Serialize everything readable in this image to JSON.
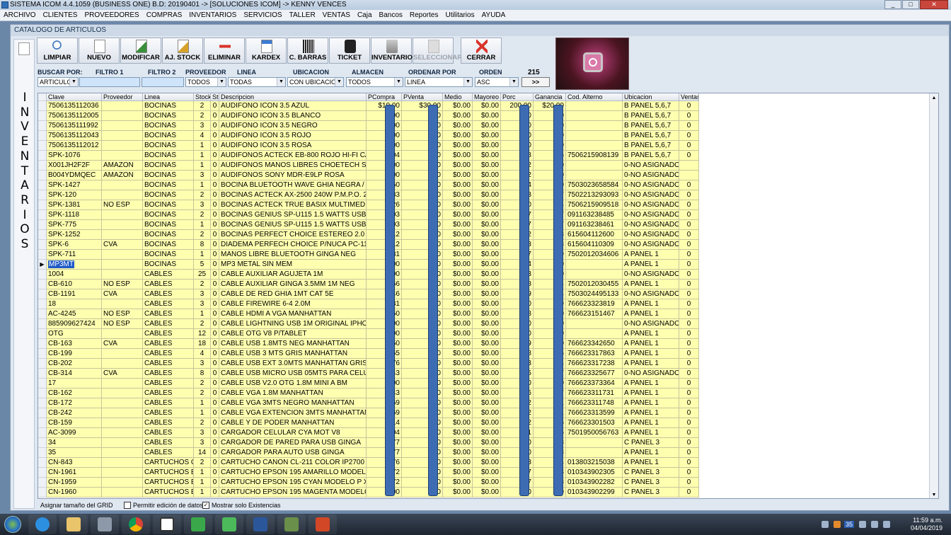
{
  "window": {
    "title": "SISTEMA ICOM 4.4.1059 (BUSINESS ONE)  B.D: 20190401  ->  [SOLUCIONES ICOM]  ->  KENNY VENCES"
  },
  "menu": [
    "ARCHIVO",
    "CLIENTES",
    "PROVEEDORES",
    "COMPRAS",
    "INVENTARIOS",
    "SERVICIOS",
    "TALLER",
    "VENTAS",
    "Caja",
    "Bancos",
    "Reportes",
    "Utilitarios",
    "AYUDA"
  ],
  "form": {
    "title": "CATALOGO DE ARTICULOS",
    "side_label": "I\nN\nV\nE\nN\nT\nA\nR\nI\nO\nS"
  },
  "toolbar": [
    {
      "label": "LIMPIAR",
      "enabled": true
    },
    {
      "label": "NUEVO",
      "enabled": true
    },
    {
      "label": "MODIFICAR",
      "enabled": true
    },
    {
      "label": "AJ. STOCK",
      "enabled": true
    },
    {
      "label": "ELIMINAR",
      "enabled": true
    },
    {
      "label": "KARDEX",
      "enabled": true
    },
    {
      "label": "C. BARRAS",
      "enabled": true
    },
    {
      "label": "TICKET",
      "enabled": true
    },
    {
      "label": "INVENTARIO",
      "enabled": true
    },
    {
      "label": "SELECCIONAR",
      "enabled": false
    },
    {
      "label": "CERRAR",
      "enabled": true
    }
  ],
  "filters": {
    "buscar_por": {
      "label": "BUSCAR POR:",
      "value": "ARTICULO"
    },
    "filtro1": {
      "label": "FILTRO 1",
      "value": ""
    },
    "filtro2": {
      "label": "FILTRO 2",
      "value": ""
    },
    "proveedor": {
      "label": "PROVEEDOR",
      "value": "TODOS"
    },
    "linea": {
      "label": "LINEA",
      "value": "TODAS"
    },
    "ubicacion": {
      "label": "UBICACION",
      "value": "CON UBICACION"
    },
    "almacen": {
      "label": "ALMACEN",
      "value": "TODOS"
    },
    "ordenar_por": {
      "label": "ORDENAR POR",
      "value": "LINEA"
    },
    "orden": {
      "label": "ORDEN",
      "value": "ASC"
    },
    "count": "215",
    "go_label": ">>"
  },
  "grid": {
    "columns": [
      "Clave",
      "Proveedor",
      "Linea",
      "Stock",
      "Sto",
      "Descripcion",
      "PCompra",
      "PVenta",
      "Medio",
      "Mayoreo",
      "Porc",
      "Ganancia",
      "Cod. Alterno",
      "Ubicacion",
      "Ventas"
    ],
    "selected_row": 16,
    "rows": [
      [
        "7506135112036",
        "",
        "BOCINAS",
        "2",
        "0",
        "AUDIFONO ICON 3.5 AZUL",
        "$10.00",
        "$30.00",
        "$0.00",
        "$0.00",
        "200.00",
        "$20.00",
        "",
        "B PANEL 5,6,7",
        "0"
      ],
      [
        "7506135112005",
        "",
        "BOCINAS",
        "2",
        "0",
        "AUDIFONO ICON 3.5 BLANCO",
        ".00",
        ".00",
        "$0.00",
        "$0.00",
        ".00",
        ".00",
        "",
        "B PANEL 5,6,7",
        "0"
      ],
      [
        "7506135111992",
        "",
        "BOCINAS",
        "3",
        "0",
        "AUDIFONO ICON 3.5 NEGRO",
        ".00",
        ".00",
        "$0.00",
        "$0.00",
        ".00",
        ".00",
        "",
        "B PANEL 5,6,7",
        "0"
      ],
      [
        "7506135112043",
        "",
        "BOCINAS",
        "4",
        "0",
        "AUDIFONO ICON 3.5 ROJO",
        ".00",
        ".00",
        "$0.00",
        "$0.00",
        ".00",
        ".00",
        "",
        "B PANEL 5,6,7",
        "0"
      ],
      [
        "7506135112012",
        "",
        "BOCINAS",
        "1",
        "0",
        "AUDIFONO ICON 3.5 ROSA",
        ".00",
        ".00",
        "$0.00",
        "$0.00",
        ".00",
        ".00",
        "",
        "B PANEL 5,6,7",
        "0"
      ],
      [
        "SPK-1076",
        "",
        "BOCINAS",
        "1",
        "0",
        "AUDIFONOS ACTECK EB-800 ROJO HI-FI CAB",
        ".04",
        ".00",
        "$0.00",
        "$0.00",
        ".68",
        ".96",
        "7506215908139",
        "B PANEL 5,6,7",
        "0"
      ],
      [
        "X001JH2F2F",
        "AMAZON",
        "BOCINAS",
        "1",
        "0",
        "AUDIFONOS MANOS LIBRES CHOETECH SUPE",
        ".00",
        ".00",
        "$0.00",
        "$0.00",
        ".52",
        ".00",
        "",
        "0-NO ASIGNADO",
        ""
      ],
      [
        "B004YDMQEC",
        "AMAZON",
        "BOCINAS",
        "3",
        "0",
        "AUDIFONOS SONY MDR-E9LP ROSA",
        ".00",
        ".00",
        "$0.00",
        "$0.00",
        ".92",
        ".00",
        "",
        "0-NO ASIGNADO",
        ""
      ],
      [
        "SPK-1427",
        "",
        "BOCINAS",
        "1",
        "0",
        "BOCINA BLUETOOTH WAVE GHIA NEGRA / NE",
        ".60",
        ".00",
        "$0.00",
        "$0.00",
        ".94",
        ".40",
        "7503023658584",
        "0-NO ASIGNADO",
        "0"
      ],
      [
        "SPK-120",
        "",
        "BOCINAS",
        "2",
        "0",
        "BOCINAS ACTECK AX-2500 240W P.M.P.O. 2",
        ".83",
        ".00",
        "$0.00",
        "$0.00",
        ".53",
        ".17",
        "7502213293093",
        "0-NO ASIGNADO",
        "0"
      ],
      [
        "SPK-1381",
        "NO ESP",
        "BOCINAS",
        "3",
        "0",
        "BOCINAS ACTECK TRUE BASIX MULTIMEDIA",
        ".26",
        ".00",
        "$0.00",
        "$0.00",
        ".10",
        ".74",
        "7506215909518",
        "0-NO ASIGNADO",
        "0"
      ],
      [
        "SPK-1118",
        "",
        "BOCINAS",
        "2",
        "0",
        "BOCINAS GENIUS SP-U115 1.5 WATTS USB A",
        ".03",
        ".00",
        "$0.00",
        "$0.00",
        ".27",
        ".97",
        "091163238485",
        "0-NO ASIGNADO",
        "0"
      ],
      [
        "SPK-775",
        "",
        "BOCINAS",
        "1",
        "0",
        "BOCINAS GENIUS SP-U115 1.5 WATTS USB N",
        ".03",
        ".00",
        "$0.00",
        "$0.00",
        ".27",
        ".97",
        "091163238461",
        "0-NO ASIGNADO",
        "0"
      ],
      [
        "SPK-1252",
        "",
        "BOCINAS",
        "2",
        "0",
        "BOCINAS PERFECT CHOICE ESTEREO 2.0 USE",
        ".12",
        ".00",
        "$0.00",
        "$0.00",
        ".12",
        ".88",
        "615604112600",
        "0-NO ASIGNADO",
        "0"
      ],
      [
        "SPK-6",
        "CVA",
        "BOCINAS",
        "8",
        "0",
        "DIADEMA PERFECH CHOICE P/NUCA PC-1103",
        ".12",
        ".00",
        "$0.00",
        "$0.00",
        ".23",
        ".88",
        "615604110309",
        "0-NO ASIGNADO",
        "0"
      ],
      [
        "SPK-711",
        "",
        "BOCINAS",
        "1",
        "0",
        "MANOS LIBRE BLUETOOTH GINGA NEG",
        ".81",
        ".00",
        "$0.00",
        "$0.00",
        ".67",
        ".19",
        "7502012034606",
        "A PANEL 1",
        "0"
      ],
      [
        "MP3MT",
        "",
        "BOCINAS",
        "5",
        "0",
        "MP3 METAL SIN MEM",
        ".00",
        ".00",
        "$0.00",
        "$0.00",
        ".14",
        ".00",
        "",
        "A PANEL 1",
        "0"
      ],
      [
        "1004",
        "",
        "CABLES",
        "25",
        "0",
        "CABLE AUXILIAR AGUJETA 1M",
        ".00",
        ".00",
        "$0.00",
        "$0.00",
        ".33",
        ".00",
        "",
        "0-NO ASIGNADO",
        "0"
      ],
      [
        "CB-610",
        "NO ESP",
        "CABLES",
        "2",
        "0",
        "CABLE AUXILIAR GINGA 3.5MM 1M NEG",
        ".66",
        ".00",
        "$0.00",
        "$0.00",
        ".08",
        ".34",
        "7502012030455",
        "A PANEL 1",
        "0"
      ],
      [
        "CB-1191",
        "CVA",
        "CABLES",
        "3",
        "0",
        "CABLE DE RED GHIA 1MT CAT 5E",
        ".46",
        ".00",
        "$0.00",
        "$0.00",
        ".59",
        ".54",
        "7503024495133",
        "0-NO ASIGNADO",
        "0"
      ],
      [
        "18",
        "",
        "CABLES",
        "3",
        "0",
        "CABLE FIREWIRE 6-4 2.0M",
        ".31",
        ".00",
        "$0.00",
        "$0.00",
        ".00",
        ".69",
        "766623323819",
        "A PANEL 1",
        "0"
      ],
      [
        "AC-4245",
        "NO ESP",
        "CABLES",
        "1",
        "0",
        "CABLE HDMI A VGA MANHATTAN",
        ".50",
        ".00",
        "$0.00",
        "$0.00",
        ".38",
        ".50",
        "766623151467",
        "A PANEL 1",
        "0"
      ],
      [
        "885909627424",
        "NO ESP",
        "CABLES",
        "2",
        "0",
        "CABLE LIGHTNING USB 1M ORIGINAL IPHONE",
        ".00",
        ".00",
        "$0.00",
        "$0.00",
        ".00",
        ".00",
        "",
        "0-NO ASIGNADO",
        "0"
      ],
      [
        "OTG",
        "",
        "CABLES",
        "12",
        "0",
        "CABLE OTG V8 P/TABLET",
        ".00",
        ".00",
        "$0.00",
        "$0.00",
        ".00",
        ".00",
        "",
        "A PANEL 1",
        "0"
      ],
      [
        "CB-163",
        "CVA",
        "CABLES",
        "18",
        "0",
        "CABLE USB 1.8MTS NEG MANHATTAN",
        ".50",
        ".00",
        "$0.00",
        "$0.00",
        ".09",
        ".50",
        "766623342650",
        "A PANEL 1",
        "0"
      ],
      [
        "CB-199",
        "",
        "CABLES",
        "4",
        "0",
        "CABLE USB 3 MTS GRIS MANHATTAN",
        ".65",
        ".00",
        "$0.00",
        "$0.00",
        ".18",
        ".35",
        "766623317863",
        "A PANEL 1",
        "0"
      ],
      [
        "CB-202",
        "",
        "CABLES",
        "3",
        "0",
        "CABLE USB EXT 3.0MTS MANHATTAN GRIS",
        ".76",
        ".00",
        "$0.00",
        "$0.00",
        ".03",
        ".24",
        "766623317238",
        "A PANEL 1",
        "0"
      ],
      [
        "CB-314",
        "CVA",
        "CABLES",
        "8",
        "0",
        "CABLE USB MICRO USB 05MTS PARA CELULA",
        ".43",
        ".00",
        "$0.00",
        "$0.00",
        ".55",
        ".57",
        "766623325677",
        "0-NO ASIGNADO",
        "0"
      ],
      [
        "17",
        "",
        "CABLES",
        "2",
        "0",
        "CABLE USB V2.0 OTG 1.8M MINI A BM",
        ".00",
        ".00",
        "$0.00",
        "$0.00",
        ".00",
        ".00",
        "766623373364",
        "A PANEL 1",
        "0"
      ],
      [
        "CB-162",
        "",
        "CABLES",
        "2",
        "0",
        "CABLE VGA 1.8M MANHATTAN",
        ".43",
        ".00",
        "$0.00",
        "$0.00",
        ".86",
        ".57",
        "766623311731",
        "A PANEL 1",
        "0"
      ],
      [
        "CB-172",
        "",
        "CABLES",
        "1",
        "0",
        "CABLE VGA 3MTS NEGRO MANHATTAN",
        ".69",
        ".00",
        "$0.00",
        "$0.00",
        ".72",
        ".31",
        "766623311748",
        "A PANEL 1",
        "0"
      ],
      [
        "CB-242",
        "",
        "CABLES",
        "1",
        "0",
        "CABLE VGA EXTENCION 3MTS MANHATTAN",
        ".69",
        ".00",
        "$0.00",
        "$0.00",
        ".72",
        ".31",
        "766623313599",
        "A PANEL 1",
        "0"
      ],
      [
        "CB-159",
        "",
        "CABLES",
        "2",
        "0",
        "CABLE Y DE PODER MANHATTAN",
        ".14",
        ".00",
        "$0.00",
        "$0.00",
        ".72",
        ".86",
        "766623301503",
        "A PANEL 1",
        "0"
      ],
      [
        "AC-3099",
        "",
        "CABLES",
        "3",
        "0",
        "CARGADOR CELULAR CYA MOT V8",
        ".04",
        ".00",
        "$0.00",
        "$0.00",
        ".31",
        ".96",
        "7501950056763",
        "A PANEL 1",
        "0"
      ],
      [
        "34",
        "",
        "CABLES",
        "3",
        "0",
        "CARGADOR DE PARED PARA USB GINGA",
        ".77",
        ".00",
        "$0.00",
        "$0.00",
        ".00",
        ".23",
        "",
        "C PANEL 3",
        "0"
      ],
      [
        "35",
        "",
        "CABLES",
        "14",
        "0",
        "CARGADOR PARA AUTO USB GINGA",
        ".77",
        ".00",
        "$0.00",
        "$0.00",
        ".00",
        ".23",
        "",
        "A PANEL 1",
        "0"
      ],
      [
        "CN-843",
        "",
        "CARTUCHOS CA",
        "2",
        "0",
        "CARTUCHO CANON CL-211 COLOR IP2700 MF",
        ".76",
        ".00",
        "$0.00",
        "$0.00",
        ".63",
        ".24",
        "013803215038",
        "A PANEL 1",
        "0"
      ],
      [
        "CN-1961",
        "",
        "CARTUCHOS EF",
        "1",
        "0",
        "CARTUCHO EPSON 195 AMARILLO MODELO P",
        ".72",
        ".00",
        "$0.00",
        "$0.00",
        ".77",
        ".28",
        "010343902305",
        "C PANEL 3",
        "0"
      ],
      [
        "CN-1959",
        "",
        "CARTUCHOS EF",
        "1",
        "0",
        "CARTUCHO EPSON 195 CYAN MODELO P XP2",
        ".72",
        ".00",
        "$0.00",
        "$0.00",
        ".77",
        ".28",
        "010343902282",
        "C PANEL 3",
        "0"
      ],
      [
        "CN-1960",
        "",
        "CARTUCHOS EF",
        "1",
        "0",
        "CARTUCHO EPSON 195 MAGENTA MODELO P",
        ".00",
        ".00",
        "$0.00",
        "$0.00",
        ".00",
        ".00",
        "010343902299",
        "C PANEL 3",
        "0"
      ]
    ]
  },
  "statusbar": {
    "resize_label": "Asignar tamaño del GRID",
    "allow_edit": {
      "label": "Permitir edición de datos",
      "checked": false
    },
    "only_stock": {
      "label": "Mostrar solo Existencias",
      "checked": true
    }
  },
  "taskbar": {
    "time": "11:59 a.m.",
    "date": "04/04/2019",
    "badge": "35"
  }
}
